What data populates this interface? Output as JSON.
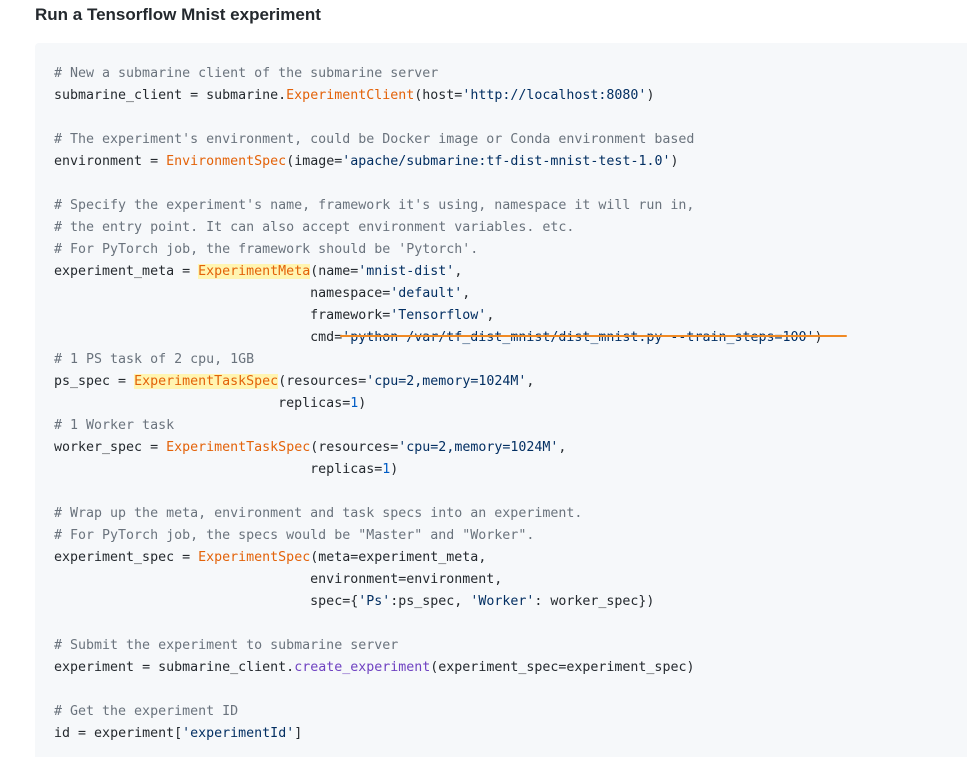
{
  "page": {
    "title": "Run a Tensorflow Mnist experiment"
  },
  "code": {
    "language": "python",
    "lines": [
      [
        {
          "t": "# New a submarine client of the submarine server",
          "c": "comment"
        }
      ],
      [
        {
          "t": "submarine_client ",
          "c": "plain"
        },
        {
          "t": "=",
          "c": "op"
        },
        {
          "t": " submarine.",
          "c": "plain"
        },
        {
          "t": "ExperimentClient",
          "c": "class"
        },
        {
          "t": "(host=",
          "c": "plain"
        },
        {
          "t": "'http://localhost:8080'",
          "c": "string"
        },
        {
          "t": ")",
          "c": "plain"
        }
      ],
      [],
      [
        {
          "t": "# The experiment's environment, could be Docker image or Conda environment based",
          "c": "comment"
        }
      ],
      [
        {
          "t": "environment ",
          "c": "plain"
        },
        {
          "t": "=",
          "c": "op"
        },
        {
          "t": " ",
          "c": "plain"
        },
        {
          "t": "EnvironmentSpec",
          "c": "class"
        },
        {
          "t": "(image=",
          "c": "plain"
        },
        {
          "t": "'apache/submarine:tf-dist-mnist-test-1.0'",
          "c": "string"
        },
        {
          "t": ")",
          "c": "plain"
        }
      ],
      [],
      [
        {
          "t": "# Specify the experiment's name, framework it's using, namespace it will run in,",
          "c": "comment"
        }
      ],
      [
        {
          "t": "# the entry point. It can also accept environment variables. etc.",
          "c": "comment"
        }
      ],
      [
        {
          "t": "# For PyTorch job, the framework should be 'Pytorch'.",
          "c": "comment"
        }
      ],
      [
        {
          "t": "experiment_meta ",
          "c": "plain"
        },
        {
          "t": "=",
          "c": "op"
        },
        {
          "t": " ",
          "c": "plain"
        },
        {
          "t": "ExperimentMeta",
          "c": "class",
          "hl": true
        },
        {
          "t": "(name=",
          "c": "plain"
        },
        {
          "t": "'mnist-dist'",
          "c": "string"
        },
        {
          "t": ",",
          "c": "plain"
        }
      ],
      [
        {
          "t": "                                namespace=",
          "c": "plain"
        },
        {
          "t": "'default'",
          "c": "string"
        },
        {
          "t": ",",
          "c": "plain"
        }
      ],
      [
        {
          "t": "                                framework=",
          "c": "plain"
        },
        {
          "t": "'Tensorflow'",
          "c": "string"
        },
        {
          "t": ",",
          "c": "plain"
        }
      ],
      [
        {
          "t": "                                cmd=",
          "c": "plain"
        },
        {
          "t": "'python /var/tf_dist_mnist/dist_mnist.py --train_steps=100'",
          "c": "string"
        },
        {
          "t": ")",
          "c": "plain"
        }
      ],
      [
        {
          "t": "# 1 PS task of 2 cpu, 1GB",
          "c": "comment"
        }
      ],
      [
        {
          "t": "ps_spec ",
          "c": "plain"
        },
        {
          "t": "=",
          "c": "op"
        },
        {
          "t": " ",
          "c": "plain"
        },
        {
          "t": "ExperimentTaskSpec",
          "c": "class",
          "hl": true
        },
        {
          "t": "(resources=",
          "c": "plain"
        },
        {
          "t": "'cpu=2,memory=1024M'",
          "c": "string"
        },
        {
          "t": ",",
          "c": "plain"
        }
      ],
      [
        {
          "t": "                            replicas=",
          "c": "plain"
        },
        {
          "t": "1",
          "c": "num"
        },
        {
          "t": ")",
          "c": "plain"
        }
      ],
      [
        {
          "t": "# 1 Worker task",
          "c": "comment"
        }
      ],
      [
        {
          "t": "worker_spec ",
          "c": "plain"
        },
        {
          "t": "=",
          "c": "op"
        },
        {
          "t": " ",
          "c": "plain"
        },
        {
          "t": "ExperimentTaskSpec",
          "c": "class"
        },
        {
          "t": "(resources=",
          "c": "plain"
        },
        {
          "t": "'cpu=2,memory=1024M'",
          "c": "string"
        },
        {
          "t": ",",
          "c": "plain"
        }
      ],
      [
        {
          "t": "                                replicas=",
          "c": "plain"
        },
        {
          "t": "1",
          "c": "num"
        },
        {
          "t": ")",
          "c": "plain"
        }
      ],
      [],
      [
        {
          "t": "# Wrap up the meta, environment and task specs into an experiment.",
          "c": "comment"
        }
      ],
      [
        {
          "t": "# For PyTorch job, the specs would be \"Master\" and \"Worker\".",
          "c": "comment"
        }
      ],
      [
        {
          "t": "experiment_spec ",
          "c": "plain"
        },
        {
          "t": "=",
          "c": "op"
        },
        {
          "t": " ",
          "c": "plain"
        },
        {
          "t": "ExperimentSpec",
          "c": "class"
        },
        {
          "t": "(meta=experiment_meta,",
          "c": "plain"
        }
      ],
      [
        {
          "t": "                                environment=environment,",
          "c": "plain"
        }
      ],
      [
        {
          "t": "                                spec={",
          "c": "plain"
        },
        {
          "t": "'Ps'",
          "c": "string"
        },
        {
          "t": ":ps_spec, ",
          "c": "plain"
        },
        {
          "t": "'Worker'",
          "c": "string"
        },
        {
          "t": ": worker_spec})",
          "c": "plain"
        }
      ],
      [],
      [
        {
          "t": "# Submit the experiment to submarine server",
          "c": "comment"
        }
      ],
      [
        {
          "t": "experiment ",
          "c": "plain"
        },
        {
          "t": "=",
          "c": "op"
        },
        {
          "t": " submarine_client.",
          "c": "plain"
        },
        {
          "t": "create_experiment",
          "c": "func"
        },
        {
          "t": "(experiment_spec=experiment_spec)",
          "c": "plain"
        }
      ],
      [],
      [
        {
          "t": "# Get the experiment ID",
          "c": "comment"
        }
      ],
      [
        {
          "t": "id ",
          "c": "plain"
        },
        {
          "t": "=",
          "c": "op"
        },
        {
          "t": " experiment[",
          "c": "plain"
        },
        {
          "t": "'experimentId'",
          "c": "string"
        },
        {
          "t": "]",
          "c": "plain"
        }
      ]
    ]
  },
  "colors": {
    "code_background": "#f6f8fa",
    "comment": "#6a737d",
    "class_name": "#e36209",
    "string": "#032f62",
    "number": "#005cc5",
    "function": "#6f42c1",
    "highlight": "#fff5b1",
    "annotation_underline": "#f08a24"
  }
}
